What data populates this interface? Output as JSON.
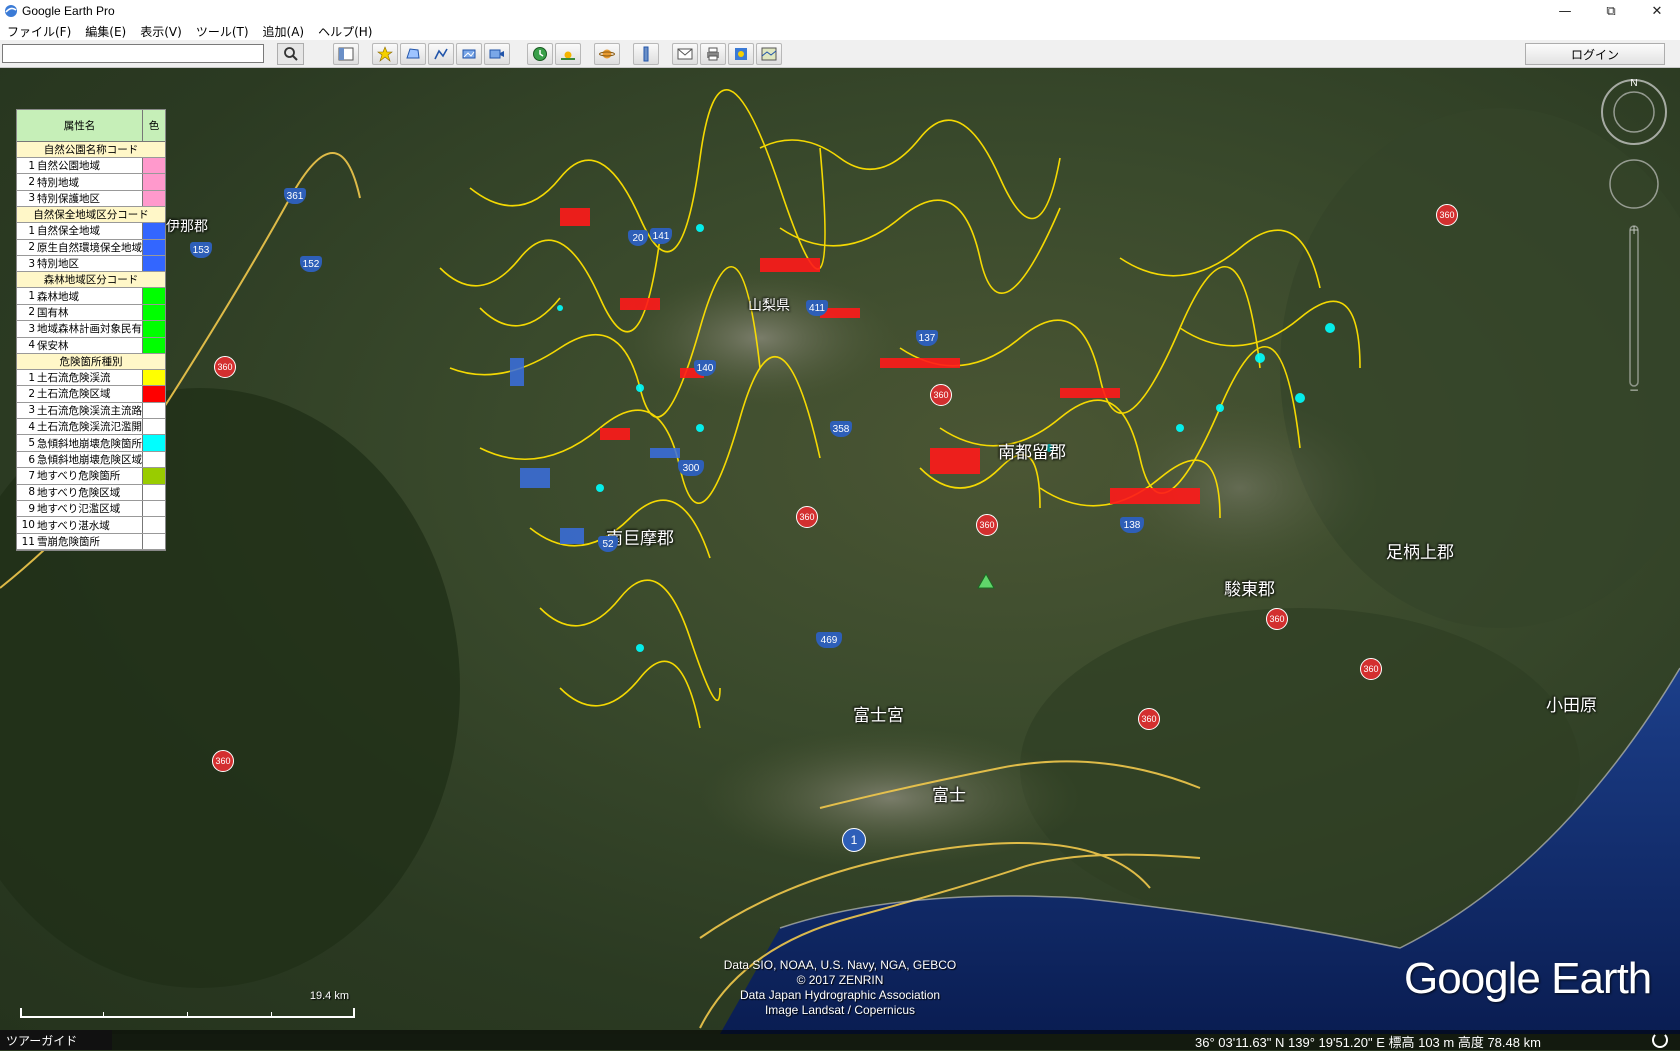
{
  "window": {
    "title": "Google Earth Pro",
    "minimize_glyph": "—",
    "maximize_glyph": "⧉",
    "close_glyph": "✕"
  },
  "menu": [
    "ファイル(F)",
    "編集(E)",
    "表示(V)",
    "ツール(T)",
    "追加(A)",
    "ヘルプ(H)"
  ],
  "toolbar": {
    "search_value": "",
    "login_label": "ログイン",
    "buttons": [
      "sidebar-icon",
      "placemark-icon",
      "polygon-icon",
      "path-icon",
      "overlay-icon",
      "tour-icon",
      "historical-imagery-icon",
      "sunlight-icon",
      "planets-icon",
      "ruler-icon",
      "email-icon",
      "print-icon",
      "save-image-icon",
      "view-in-maps-icon"
    ]
  },
  "legend": {
    "header_name": "属性名",
    "header_color": "色",
    "sections": [
      {
        "title": "自然公園名称コード",
        "rows": [
          {
            "num": "1",
            "label": "自然公園地域",
            "color": "#ff99cc"
          },
          {
            "num": "2",
            "label": "特別地域",
            "color": "#ff99cc"
          },
          {
            "num": "3",
            "label": "特別保護地区",
            "color": "#ff99cc"
          }
        ]
      },
      {
        "title": "自然保全地域区分コード",
        "rows": [
          {
            "num": "1",
            "label": "自然保全地域",
            "color": "#3366ff"
          },
          {
            "num": "2",
            "label": "原生自然環境保全地域",
            "color": "#3366ff"
          },
          {
            "num": "3",
            "label": "特別地区",
            "color": "#3366ff"
          }
        ]
      },
      {
        "title": "森林地域区分コード",
        "rows": [
          {
            "num": "1",
            "label": "森林地域",
            "color": "#00ff00"
          },
          {
            "num": "2",
            "label": "国有林",
            "color": "#00ff00"
          },
          {
            "num": "3",
            "label": "地域森林計画対象民有林",
            "color": "#00ff00"
          },
          {
            "num": "4",
            "label": "保安林",
            "color": "#00ff00"
          }
        ]
      },
      {
        "title": "危険箇所種別",
        "rows": [
          {
            "num": "1",
            "label": "土石流危険渓流",
            "color": "#ffff00"
          },
          {
            "num": "2",
            "label": "土石流危険区域",
            "color": "#ff0000"
          },
          {
            "num": "3",
            "label": "土石流危険渓流主流路",
            "color": "#ffffff"
          },
          {
            "num": "4",
            "label": "土石流危険渓流氾濫開始点",
            "color": "#ffffff"
          },
          {
            "num": "5",
            "label": "急傾斜地崩壊危険箇所",
            "color": "#00ffff"
          },
          {
            "num": "6",
            "label": "急傾斜地崩壊危険区域",
            "color": "#ffffff"
          },
          {
            "num": "7",
            "label": "地すべり危険箇所",
            "color": "#99cc00"
          },
          {
            "num": "8",
            "label": "地すべり危険区域",
            "color": "#ffffff"
          },
          {
            "num": "9",
            "label": "地すべり氾濫区域",
            "color": "#ffffff"
          },
          {
            "num": "10",
            "label": "地すべり湛水域",
            "color": "#ffffff"
          },
          {
            "num": "11",
            "label": "雪崩危険箇所",
            "color": "#ffffff"
          }
        ]
      }
    ]
  },
  "places": [
    {
      "name": "伊那郡",
      "cls": "small"
    },
    {
      "name": "山梨県",
      "cls": "small"
    },
    {
      "name": "南都留郡",
      "cls": ""
    },
    {
      "name": "南巨摩郡",
      "cls": ""
    },
    {
      "name": "足柄上郡",
      "cls": ""
    },
    {
      "name": "駿東郡",
      "cls": ""
    },
    {
      "name": "小田原",
      "cls": ""
    },
    {
      "name": "富士宮",
      "cls": ""
    },
    {
      "name": "富士",
      "cls": ""
    }
  ],
  "routes": [
    "361",
    "153",
    "152",
    "20",
    "141",
    "411",
    "137",
    "140",
    "358",
    "300",
    "52",
    "138",
    "469",
    "1"
  ],
  "badge_label": "360",
  "attribution": [
    "Data SIO, NOAA, U.S. Navy, NGA, GEBCO",
    "© 2017 ZENRIN",
    "Data Japan Hydrographic Association",
    "Image Landsat / Copernicus"
  ],
  "logo": "Google Earth",
  "scale": {
    "label": "19.4 km"
  },
  "compass_north": "N",
  "status": {
    "tour_guide": "ツアーガイド",
    "coordinates": "36° 03'11.63\" N 139° 19'51.20\" E 標高  103 m   高度  78.48 km"
  },
  "colors": {
    "debris_stream": "#ffff00",
    "debris_area": "#ff0000",
    "steep_slope": "#00ffff",
    "nature_reserve": "#3366ff",
    "road": "#f2c94c"
  }
}
